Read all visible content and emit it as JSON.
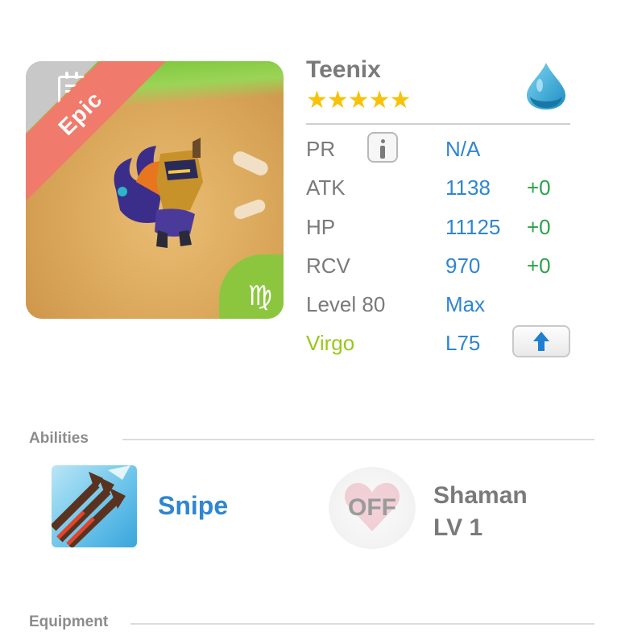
{
  "monster": {
    "name": "Teenix",
    "rarity_label": "Epic",
    "stars": "★★★★★",
    "star_count": 5,
    "element_icon": "water-drop-icon",
    "zodiac_glyph": "♍"
  },
  "stats": {
    "pr": {
      "label": "PR",
      "value": "N/A"
    },
    "atk": {
      "label": "ATK",
      "value": "1138",
      "bonus": "+0"
    },
    "hp": {
      "label": "HP",
      "value": "11125",
      "bonus": "+0"
    },
    "rcv": {
      "label": "RCV",
      "value": "970",
      "bonus": "+0"
    },
    "level": {
      "label": "Level 80",
      "value": "Max"
    },
    "zodiac": {
      "label": "Virgo",
      "value": "L75"
    }
  },
  "abilities": {
    "title": "Abilities",
    "skill": {
      "name": "Snipe",
      "icon": "arrows-skill-icon"
    },
    "leader": {
      "status": "OFF",
      "name_line1": "Shaman",
      "name_line2": "LV 1"
    }
  },
  "equipment": {
    "title": "Equipment"
  },
  "colors": {
    "rarity_ribbon": "#f07a6b",
    "value_blue": "#2f86d0",
    "bonus_green": "#2aa24a",
    "zodiac_green": "#97c81c",
    "star_yellow": "#f8c20a"
  }
}
